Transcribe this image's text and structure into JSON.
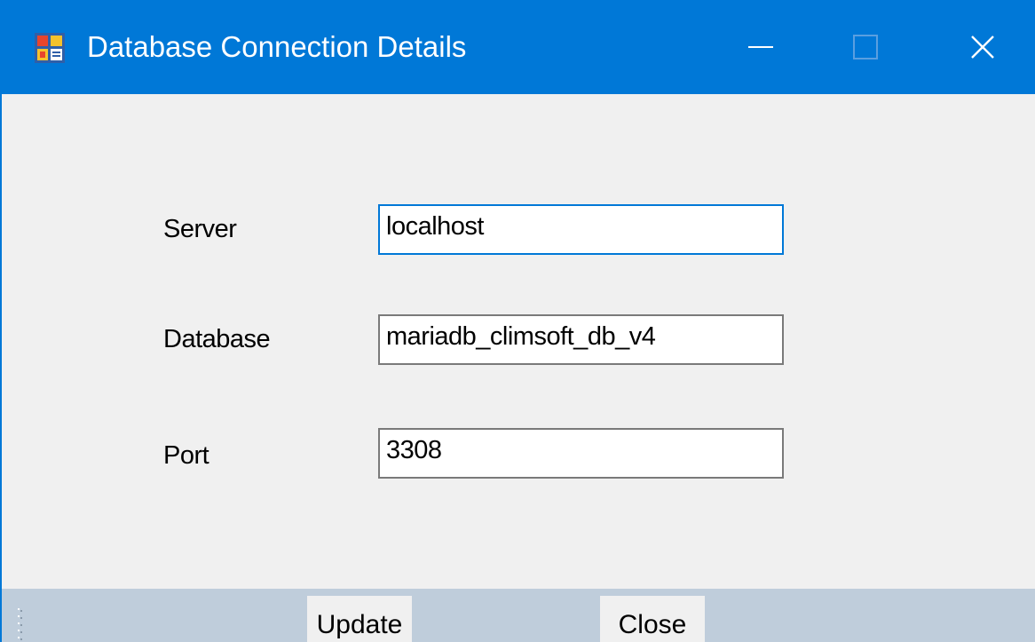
{
  "window": {
    "title": "Database Connection Details"
  },
  "titlebar_buttons": {
    "minimize": "minimize-icon",
    "maximize": "maximize-icon",
    "close": "close-icon"
  },
  "form": {
    "server_label": "Server",
    "server_value": "localhost",
    "database_label": "Database",
    "database_value": "mariadb_climsoft_db_v4",
    "port_label": "Port",
    "port_value": "3308"
  },
  "toolbar": {
    "update_label": "Update",
    "close_label": "Close"
  },
  "colors": {
    "titlebar": "#0078d7",
    "window_bg": "#f0f0f0",
    "statusbar": "#bfcddb",
    "focus_border": "#0078d7",
    "input_border": "#7a7a7a"
  }
}
